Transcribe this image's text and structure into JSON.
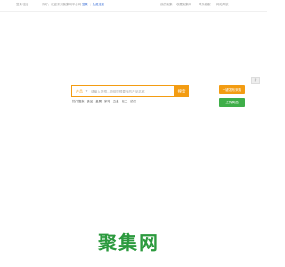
{
  "topbar": {
    "left_link": "登录/注册",
    "left_text": "你好，欢迎来到聚集网平台网",
    "login": "登录",
    "register": "免费注册",
    "right_links": [
      "我的聚集",
      "收藏聚集网",
      "联系客服",
      "网站导航"
    ]
  },
  "search": {
    "category": "产品",
    "placeholder": "请输入您想...说明您想要找的产品名称",
    "button": "搜索"
  },
  "hotwords": {
    "label": "热门搜索",
    "items": [
      "食品",
      "金属",
      "家电",
      "五金",
      "化工",
      "纺织"
    ]
  },
  "side": {
    "badge": "新",
    "post_button": "一键发布采购",
    "publish_button": "上传商品"
  },
  "logo": {
    "text": "聚集网",
    "color": "#2c9a3e"
  },
  "colors": {
    "accent": "#f39c12",
    "green": "#3fae49",
    "link": "#3b6fd6"
  }
}
